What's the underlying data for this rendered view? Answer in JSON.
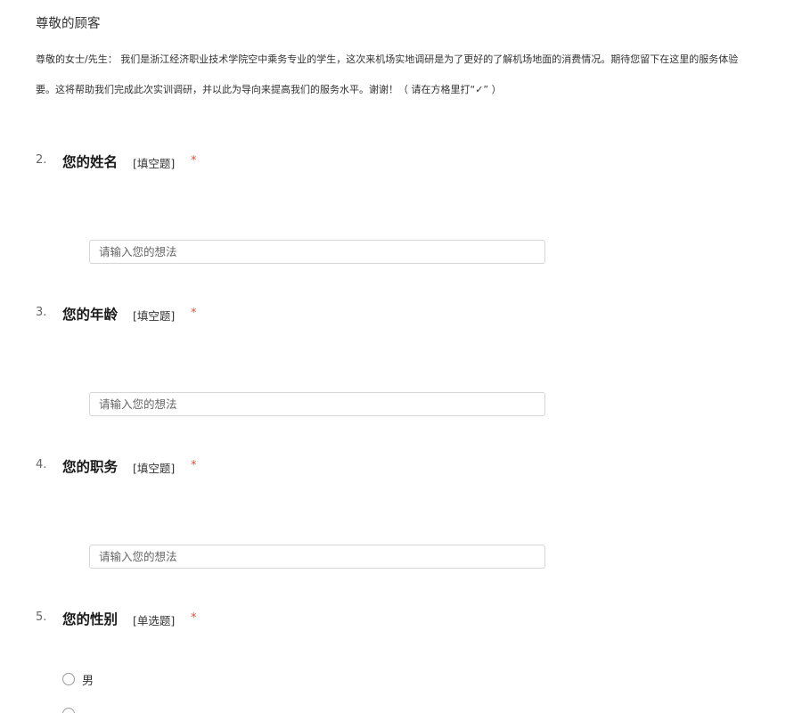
{
  "header": {
    "title": "尊敬的顾客",
    "intro_line_1": "尊敬的女士/先生： 我们是浙江经济职业技术学院空中乘务专业的学生，这次来机场实地调研是为了更好的了解机场地面的消费情况。期待您留下在这里的服务体验",
    "intro_line_2": "要。这将帮助我们完成此次实训调研，并以此为导向来提高我们的服务水平。谢谢！（ 请在方格里打“✓” ）"
  },
  "questions": [
    {
      "number": "2.",
      "title": "您的姓名",
      "type": "[填空题]",
      "required_mark": "*",
      "input_placeholder": "请输入您的想法"
    },
    {
      "number": "3.",
      "title": "您的年龄",
      "type": "[填空题]",
      "required_mark": "*",
      "input_placeholder": "请输入您的想法"
    },
    {
      "number": "4.",
      "title": "您的职务",
      "type": "[填空题]",
      "required_mark": "*",
      "input_placeholder": "请输入您的想法"
    },
    {
      "number": "5.",
      "title": "您的性别",
      "type": "[单选题]",
      "required_mark": "*",
      "options": [
        "男",
        ""
      ]
    }
  ]
}
